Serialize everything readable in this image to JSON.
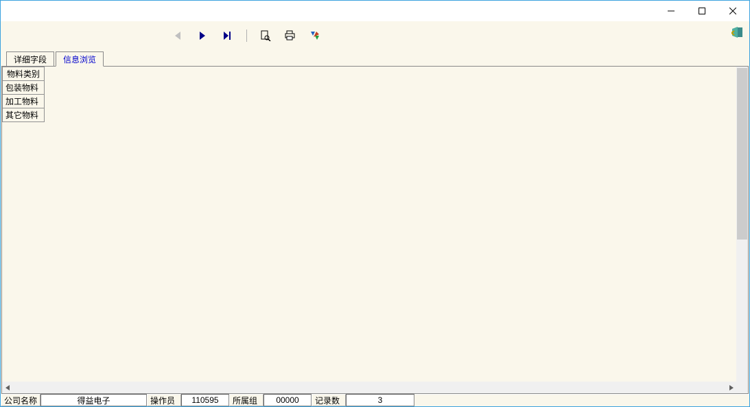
{
  "tabs": [
    {
      "label": "详细字段",
      "active": false
    },
    {
      "label": "信息浏览",
      "active": true
    }
  ],
  "table": {
    "columns": [
      "物料类别"
    ],
    "rows": [
      {
        "category": "包装物料"
      },
      {
        "category": "加工物料"
      },
      {
        "category": "其它物料"
      }
    ]
  },
  "status": {
    "company_label": "公司名称",
    "company_value": "得益电子",
    "operator_label": "操作员",
    "operator_value": "110595",
    "group_label": "所属组",
    "group_value": "00000",
    "count_label": "记录数",
    "count_value": "3"
  },
  "icons": {
    "nav_prev": "triangle-left-icon",
    "nav_next": "triangle-right-icon",
    "nav_last": "triangle-right-bar-icon",
    "preview": "page-magnify-icon",
    "print": "printer-icon",
    "export": "export-icon",
    "exit": "door-exit-icon"
  },
  "colors": {
    "window_border": "#3aa2de",
    "client_bg": "#faf7eb",
    "active_tab_text": "#0000cc",
    "nav_active": "#000088",
    "nav_disabled": "#c0c0c0"
  }
}
